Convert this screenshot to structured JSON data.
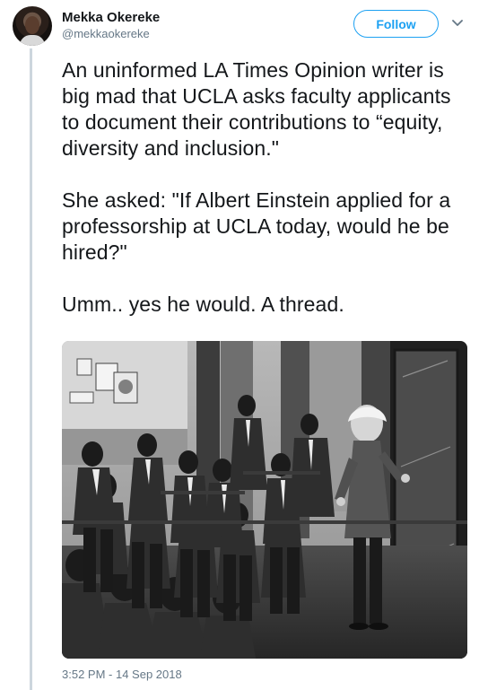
{
  "tweet": {
    "author": {
      "display_name": "Mekka Okereke",
      "handle": "@mekkaokereke",
      "avatar_icon": "profile-photo"
    },
    "follow_button_label": "Follow",
    "menu_icon": "chevron-down-icon",
    "paragraphs": [
      "An uninformed LA Times Opinion writer is big mad that UCLA asks faculty applicants to document their contributions to “equity, diversity and inclusion.\"",
      "She asked: \"If Albert Einstein applied for a professorship at UCLA today, would he be hired?\"",
      "Umm.. yes he would. A thread."
    ],
    "timestamp": "3:52 PM - 14 Sep 2018",
    "photo": {
      "description": "Historic black-and-white photo of a lecture",
      "accent_colors": {
        "line": "#ccd6dd",
        "link": "#1da1f2",
        "muted": "#657786"
      }
    }
  }
}
